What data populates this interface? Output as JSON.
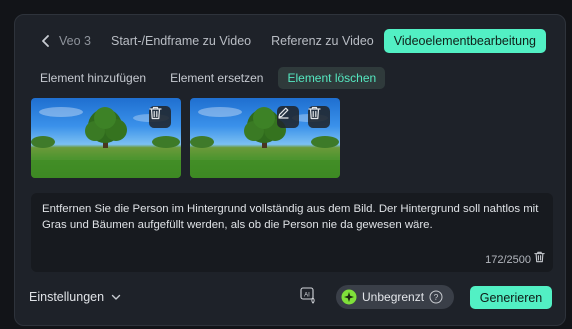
{
  "tabs": [
    {
      "label": "Veo 3"
    },
    {
      "label": "Start-/Endframe zu Video"
    },
    {
      "label": "Referenz zu Video"
    },
    {
      "label": "Videoelementbearbeitung"
    }
  ],
  "subtabs": [
    {
      "label": "Element hinzufügen"
    },
    {
      "label": "Element ersetzen"
    },
    {
      "label": "Element löschen"
    }
  ],
  "prompt": {
    "text": "Entfernen Sie die Person im Hintergrund vollständig aus dem Bild. Der Hintergrund soll nahtlos mit Gras und Bäumen aufgefüllt werden, als ob die Person nie da gewesen wäre.",
    "counter": "172/2500"
  },
  "footer": {
    "settings_label": "Einstellungen",
    "unlimited_label": "Unbegrenzt",
    "generate_label": "Generieren"
  },
  "colors": {
    "accent": "#52f0c4",
    "panel": "#1e2229",
    "prompt_bg": "#171a1f"
  }
}
